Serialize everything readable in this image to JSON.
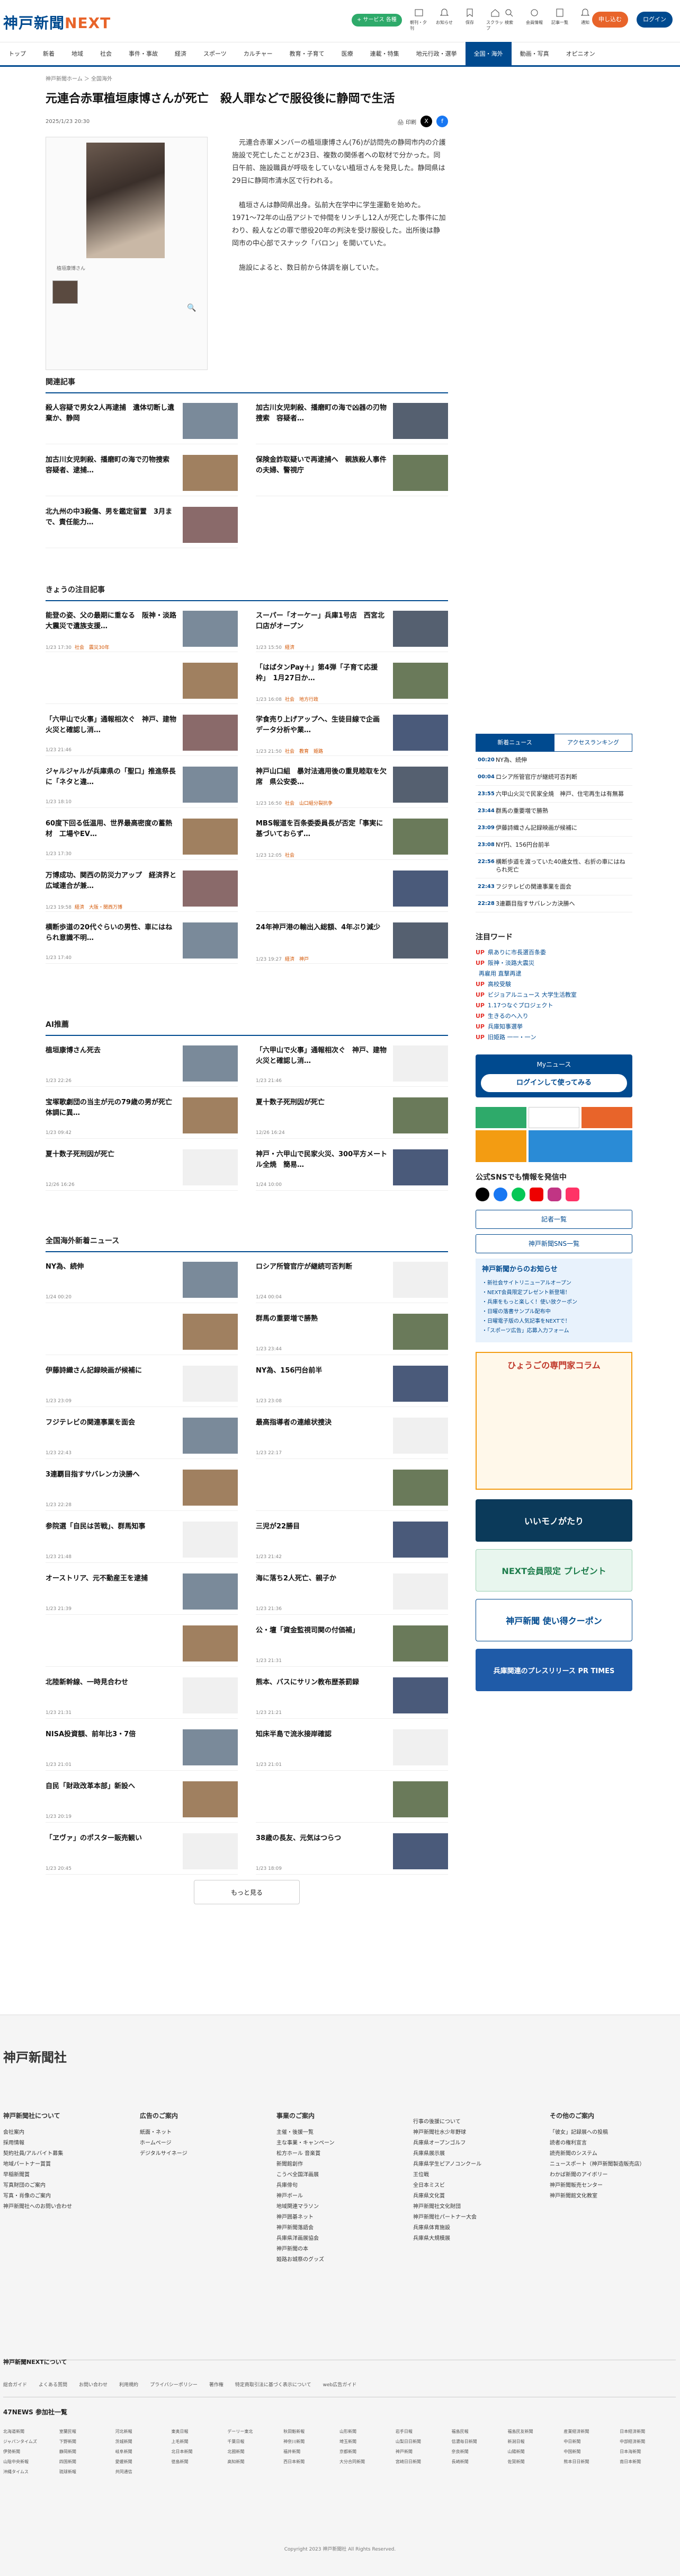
{
  "header": {
    "logo": "神戸新聞",
    "logo_next": "NEXT",
    "service_btn": "+ サービス 各種",
    "icons": [
      {
        "name": "menu-icon",
        "label": "朝刊・夕刊"
      },
      {
        "name": "bell-icon",
        "label": "お知らせ"
      },
      {
        "name": "bookmark-icon",
        "label": "保存"
      },
      {
        "name": "home-icon",
        "label": "スクラップ"
      },
      {
        "name": "search-icon",
        "label": "検索"
      },
      {
        "name": "gear-icon",
        "label": "会員情報"
      },
      {
        "name": "news-icon",
        "label": "記事一覧"
      },
      {
        "name": "bell2-icon",
        "label": "通知"
      }
    ],
    "apply": "申し込む",
    "login": "ログイン"
  },
  "nav": [
    "トップ",
    "新着",
    "地域",
    "社会",
    "事件・事故",
    "経済",
    "スポーツ",
    "カルチャー",
    "教育・子育て",
    "医療",
    "連載・特集",
    "地元行政・選挙",
    "全国・海外",
    "動画・写真",
    "オピニオン"
  ],
  "nav_active": 12,
  "breadcrumb": "神戸新聞ホーム ＞ 全国海外",
  "article": {
    "title": "元連合赤軍植垣康博さんが死亡　殺人罪などで服役後に静岡で生活",
    "date": "2025/1/23 20:30",
    "print": "印刷",
    "caption": "植垣康博さん",
    "paragraphs": [
      "元連合赤軍メンバーの植垣康博さん(76)が訪問先の静岡市内の介護施設で死亡したことが23日、複数の関係者への取材で分かった。同日午前、施設職員が呼吸をしていない植垣さんを発見した。静岡県は29日に静岡市清水区で行われる。",
      "植垣さんは静岡県出身。弘前大在学中に学生運動を始めた。1971〜72年の山岳アジトで仲間をリンチし12人が死亡した事件に加わり、殺人などの罪で懲役20年の判決を受け服役した。出所後は静岡市の中心部でスナック「バロン」を開いていた。",
      "施設によると、数日前から体調を崩していた。"
    ]
  },
  "related": {
    "heading": "関連記事",
    "items": [
      {
        "title": "殺人容疑で男女2人再逮捕　遺体切断し遺棄か、静岡",
        "date": ""
      },
      {
        "title": "加古川女児刺殺、播磨町の海で凶器の刃物捜索　容疑者…",
        "date": ""
      },
      {
        "title": "加古川女児刺殺、播磨町の海で刃物捜索　容疑者、逮捕…",
        "date": ""
      },
      {
        "title": "保険金詐取疑いで再逮捕へ　親族殺人事件の夫婦、警視庁",
        "date": ""
      },
      {
        "title": "北九州の中3殺傷、男を鑑定留置　3月まで、責任能力…",
        "date": ""
      }
    ]
  },
  "attention": {
    "heading": "きょうの注目記事",
    "items": [
      {
        "title": "能登の姿、父の最期に重なる　阪神・淡路大震災で遺族支援…",
        "date": "1/23 17:30",
        "tag": "社会　震災30年"
      },
      {
        "title": "スーパー「オーケー」兵庫1号店　西宮北口店がオープン",
        "date": "1/23 15:50",
        "tag": "経済"
      },
      {
        "title": "",
        "date": "",
        "tag": ""
      },
      {
        "title": "「はばタンPay＋」第4弾「子育て応援枠」　1月27日か…",
        "date": "1/23 16:08",
        "tag": "社会　地方行政"
      },
      {
        "title": "「六甲山で火事」通報相次ぐ　神戸、建物火災と確認し消…",
        "date": "1/23 21:46",
        "tag": ""
      },
      {
        "title": "学食売り上げアップへ、生徒目線で企画　データ分析や業…",
        "date": "1/23 21:50",
        "tag": "社会　教育　姫路"
      },
      {
        "title": "ジャルジャルが兵庫県の「聖口」推進祭長に「ネタと違…",
        "date": "1/23 18:10",
        "tag": ""
      },
      {
        "title": "神戸山口組　暴対法適用後の重見睦取を欠席　県公安委…",
        "date": "1/23 16:50",
        "tag": "社会　山口組分裂抗争"
      },
      {
        "title": "60度下回る低温用、世界最高密度の蓄熱材　工場やEV…",
        "date": "1/23 17:30",
        "tag": ""
      },
      {
        "title": "MBS報道を百条委委員長が否定「事実に基づいておらず…",
        "date": "1/23 12:05",
        "tag": "社会"
      },
      {
        "title": "万博成功、関西の防災力アップ　経済界と広域連合が兼…",
        "date": "1/23 19:58",
        "tag": "経済　大阪・関西万博"
      },
      {
        "title": "",
        "date": "",
        "tag": ""
      },
      {
        "title": "横断歩道の20代ぐらいの男性、車にはねられ意識不明…",
        "date": "1/23 17:40",
        "tag": ""
      },
      {
        "title": "24年神戸港の輸出入総額、4年ぶり減少",
        "date": "1/23 19:27",
        "tag": "経済　神戸"
      }
    ]
  },
  "ai": {
    "heading": "AI推薦",
    "items": [
      {
        "title": "植垣康博さん死去",
        "date": "1/23 22:26"
      },
      {
        "title": "「六甲山で火事」通報相次ぐ　神戸、建物火災と確認し消…",
        "date": "1/23 21:46"
      },
      {
        "title": "宝塚歌劇団の当主が元の79歳の男が死亡　体調に異…",
        "date": "1/23 09:42"
      },
      {
        "title": "夏十数子死刑因が死亡",
        "date": "12/26 16:24"
      },
      {
        "title": "夏十数子死刑因が死亡",
        "date": "12/26 16:26"
      },
      {
        "title": "神戸・六甲山で民家火災、300平方メートル全焼　簡易…",
        "date": "1/24 10:00"
      }
    ]
  },
  "national": {
    "heading": "全国海外新着ニュース",
    "items": [
      {
        "title": "NY為、続伸",
        "date": "1/24 00:20"
      },
      {
        "title": "ロシア所管官庁が継続可否判断",
        "date": "1/24 00:04"
      },
      {
        "title": "",
        "date": ""
      },
      {
        "title": "群馬の重要増で勝熟",
        "date": "1/23 23:44"
      },
      {
        "title": "伊藤詩織さん記録映画が候補に",
        "date": "1/23 23:09"
      },
      {
        "title": "NY為、156円台前半",
        "date": "1/23 23:08"
      },
      {
        "title": "フジテレビの関連事業を面会",
        "date": "1/23 22:43"
      },
      {
        "title": "最高指導者の連維状捜決",
        "date": "1/23 22:17"
      },
      {
        "title": "3連覇目指すサバレンカ決勝へ",
        "date": "1/23 22:28"
      },
      {
        "title": "",
        "date": ""
      },
      {
        "title": "参院選「自民は苦戦」、群馬知事",
        "date": "1/23 21:48"
      },
      {
        "title": "三児が22勝目",
        "date": "1/23 21:42"
      },
      {
        "title": "オーストリア、元不動産王を逮捕",
        "date": "1/23 21:39"
      },
      {
        "title": "海に落ち2人死亡、親子か",
        "date": "1/23 21:36"
      },
      {
        "title": "",
        "date": ""
      },
      {
        "title": "公・壇「資金監視司関の付価補」",
        "date": "1/23 21:31"
      },
      {
        "title": "北陸新幹線、一時見合わせ",
        "date": "1/23 21:31"
      },
      {
        "title": "熊本、バスにサリン教布歴茶罰録",
        "date": "1/23 21:21"
      },
      {
        "title": "NISA投資額、前年比3・7倍",
        "date": "1/23 21:01"
      },
      {
        "title": "知床半島で流氷接岸確認",
        "date": "1/23 21:01"
      },
      {
        "title": "自民「財政改革本部」新設へ",
        "date": "1/23 20:19"
      },
      {
        "title": "",
        "date": ""
      },
      {
        "title": "「ヱヴァ」のポスター販売観い",
        "date": "1/23 20:45"
      },
      {
        "title": "38歳の長友、元気はつらつ",
        "date": "1/23 18:09"
      }
    ],
    "more": "もっと見る"
  },
  "side": {
    "tabs": [
      "新着ニュース",
      "アクセスランキング"
    ],
    "ranking": [
      {
        "time": "00:20",
        "title": "NY為、続伸"
      },
      {
        "time": "00:04",
        "title": "ロシア所管官庁が継続可否判断"
      },
      {
        "time": "23:55",
        "title": "六甲山火災で民家全焼　神戸、住宅再生は有無募"
      },
      {
        "time": "23:44",
        "title": "群馬の重要増で勝熟"
      },
      {
        "time": "23:09",
        "title": "伊藤詩織さん記録映画が候補に"
      },
      {
        "time": "23:08",
        "title": "NY円、156円台前半"
      },
      {
        "time": "22:56",
        "title": "横断歩道を渡っていた40歳女性、右折の車にはねられ死亡"
      },
      {
        "time": "22:43",
        "title": "フジテレビの関連事業を面会"
      },
      {
        "time": "22:28",
        "title": "3連覇目指すサバレンカ決勝へ"
      }
    ],
    "focus_heading": "注目ワード",
    "keywords": [
      {
        "up": "UP",
        "word": "県ありに市長選百条委"
      },
      {
        "up": "UP",
        "word": "阪神・淡路大震災"
      },
      {
        "up": "",
        "word": "再雇用 直撃再逮"
      },
      {
        "up": "UP",
        "word": "高校受験"
      },
      {
        "up": "UP",
        "word": "ビジョアルニュース 大学生活教室"
      },
      {
        "up": "UP",
        "word": "1.17つなぐプロジェクト"
      },
      {
        "up": "UP",
        "word": "生きるのへ入り"
      },
      {
        "up": "UP",
        "word": "兵庫知事選挙"
      },
      {
        "up": "UP",
        "word": "旧姫路 一一・一ン"
      }
    ],
    "mynews": "Myニュース",
    "mynews_btn": "ログインして使ってみる",
    "sns_heading": "公式SNSでも情報を発信中",
    "btn1": "記者一覧",
    "btn2": "神戸新聞SNS一覧",
    "notice_heading": "神戸新聞からのお知らせ",
    "notices": [
      "・新社会サイトリニューアルオープン",
      "・NEXT会員限定プレゼント新登場！",
      "・兵庫をもっと楽しく！使い放クーポン",
      "・日曜の落書サンプル配布中",
      "・日曜電子版の人気記事をNEXTで！",
      "・「スポーツ広告」応募入力フォーム"
    ],
    "column_title": "ひょうごの専門家コラム",
    "banners": [
      "いいモノがたり",
      "NEXT会員限定 プレゼント",
      "神戸新聞 使い得クーポン",
      "兵庫関連のプレスリリース PR TIMES"
    ]
  },
  "footer": {
    "logo": "神戸新聞社",
    "cols": [
      {
        "h": "神戸新聞社について",
        "items": [
          "会社案内",
          "採用情報",
          "契約社員/アルバイト募集",
          "",
          "地域パートナー賞賞",
          "早稲新聞賞",
          "写真財団のご案内",
          "写真・肖像のご案内",
          "神戸新聞社へのお問い合わせ"
        ]
      },
      {
        "h": "広告のご案内",
        "items": [
          "紙面・ネット",
          "ホームページ",
          "デジタルサイネージ"
        ]
      },
      {
        "h": "事業のご案内",
        "items": [
          "主催・後援一覧",
          "",
          "主な事業・キャンペーン",
          "松方ホール 音楽賞",
          "新聞館創作",
          "こうべ全国洋画展",
          "兵庫俳句",
          "神戸ボール",
          "地域関連マラソン",
          "神戸囲碁ネット",
          "神戸新聞落語会",
          "兵庫県洋画展協会",
          "神戸新聞の本",
          "姫路お城祭のグッズ"
        ]
      },
      {
        "h": "",
        "items": [
          "行事の後援について",
          "",
          "",
          "神戸新聞社水少年野球",
          "兵庫県オープンゴルフ",
          "兵庫県展示展",
          "兵庫県学生ピアノコンクール",
          "王位戦",
          "全日本ミスビ",
          "兵庫県文化賞",
          "神戸新聞社文化財団",
          "神戸新聞社パートナー大会",
          "兵庫県体育施設",
          "兵庫県大規模展"
        ]
      },
      {
        "h": "その他のご案内",
        "items": [
          "「彼女」記録展への投稿",
          "読者の権利宣言",
          "読売新聞のシステム",
          "ニュースポート（神戸新聞製造販売店）",
          "わかば新聞のアイボリー",
          "神戸新聞販売センター",
          "神戸新聞館文化教室"
        ]
      }
    ],
    "next_heading": "神戸新聞NEXTについて",
    "links": [
      "総合ガイド",
      "よくある質問",
      "お問い合わせ",
      "利用規約",
      "プライバシーポリシー",
      "著作権",
      "特定商取引法に基づく表示について",
      "web広告ガイド"
    ],
    "news47": "47NEWS 参加社一覧",
    "papers": [
      "北海道新聞",
      "室蘭民報",
      "河北新報",
      "東奥日報",
      "デーリー東北",
      "秋田魁新報",
      "山形新聞",
      "岩手日報",
      "福島民報",
      "福島民友新聞",
      "産業経済新聞",
      "日本経済新聞",
      "ジャパンタイムズ",
      "下野新聞",
      "茨城新聞",
      "上毛新聞",
      "千葉日報",
      "神奈川新聞",
      "埼玉新聞",
      "山梨日日新聞",
      "信濃毎日新聞",
      "新潟日報",
      "中日新聞",
      "中部経済新聞",
      "伊勢新聞",
      "静岡新聞",
      "岐阜新聞",
      "北日本新聞",
      "北國新聞",
      "福井新聞",
      "京都新聞",
      "神戸新聞",
      "奈良新聞",
      "山陽新聞",
      "中国新聞",
      "日本海新聞",
      "山陰中央新報",
      "四国新聞",
      "愛媛新聞",
      "徳島新聞",
      "高知新聞",
      "西日本新聞",
      "大分合同新聞",
      "宮崎日日新聞",
      "長崎新聞",
      "佐賀新聞",
      "熊本日日新聞",
      "南日本新聞",
      "沖縄タイムス",
      "琉球新報",
      "共同通信",
      "",
      "",
      ""
    ],
    "copyright": "Copyright 2023 神戸新聞社 All Rights Reserved."
  }
}
